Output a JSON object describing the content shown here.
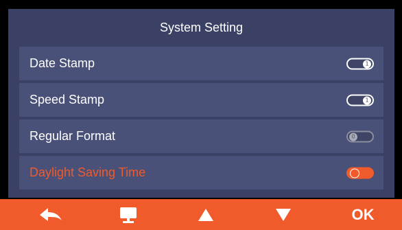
{
  "title": "System Setting",
  "colors": {
    "accent": "#f15a2b",
    "panel": "#3a4164",
    "row": "#4a5178"
  },
  "settings": [
    {
      "label": "Date Stamp",
      "state": "on",
      "indicator": "1"
    },
    {
      "label": "Speed Stamp",
      "state": "on",
      "indicator": "1"
    },
    {
      "label": "Regular Format",
      "state": "off",
      "indicator": "0"
    },
    {
      "label": "Daylight Saving Time",
      "state": "selected",
      "indicator": ""
    }
  ],
  "bottom_bar": {
    "back_icon": "back-arrow-icon",
    "display_icon": "monitor-icon",
    "up_icon": "up-triangle-icon",
    "down_icon": "down-triangle-icon",
    "ok_label": "OK"
  }
}
